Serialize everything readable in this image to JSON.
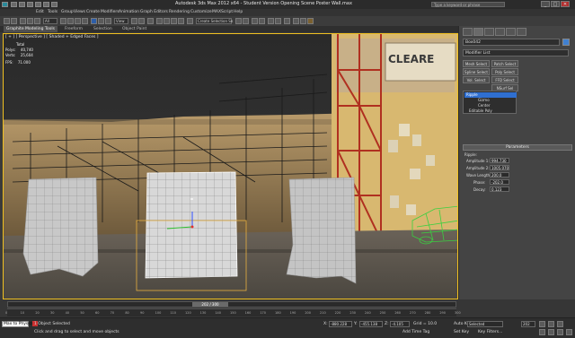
{
  "window": {
    "title": "Autodesk 3ds Max 2012 x64  -  Student Version    Opening Scene Poster Wall.max",
    "search_placeholder": "Type a keyword or phrase",
    "min_label": "_",
    "max_label": "□",
    "close_label": "✕"
  },
  "menu": {
    "items": [
      "Edit",
      "Tools",
      "Group",
      "Views",
      "Create",
      "Modifiers",
      "Animation",
      "Graph Editors",
      "Rendering",
      "Customize",
      "MAXScript",
      "Help"
    ]
  },
  "toolbar": {
    "selection_filter": "All",
    "view_dropdown": "View",
    "named_selection": "Create Selection Se"
  },
  "ribbon": {
    "tabs": [
      "Graphite Modeling Tools",
      "Freeform",
      "Selection",
      "Object Paint"
    ]
  },
  "viewport": {
    "label": "[ + ] [ Perspective ] [ Shaded + Edged Faces ]",
    "stats": {
      "header": "Total",
      "polys_label": "Polys:",
      "polys_value": "40,740",
      "verts_label": "Verts:",
      "verts_value": "25,604",
      "fps_label": "FPS:",
      "fps_value": "71.000"
    },
    "poster_text": "CLEARE",
    "colors": {
      "viewport_border": "#f0c020",
      "wire_car": "#3ad040",
      "selected_plane": "#ffffff"
    }
  },
  "command_panel": {
    "object_name": "Box042",
    "modifier_list": "Modifier List",
    "buttons": [
      "Mesh Select",
      "Patch Select",
      "Spline Select",
      "Poly Select",
      "Vol. Select",
      "FFD Select",
      "NSurf Sel"
    ],
    "stack": [
      "Ripple",
      "Gizmo",
      "Center",
      "Editable Poly"
    ],
    "parameters_title": "Parameters",
    "ripple_label": "Ripple:",
    "params": [
      {
        "label": "Amplitude 1:",
        "value": "994.730"
      },
      {
        "label": "Amplitude 2:",
        "value": "1005.070"
      },
      {
        "label": "Wave Length:",
        "value": "200.0"
      },
      {
        "label": "Phase:",
        "value": "-202.0"
      },
      {
        "label": "Decay:",
        "value": "0.123"
      }
    ]
  },
  "timeline": {
    "frame_readout": "202 / 300",
    "ticks": [
      "0",
      "10",
      "20",
      "30",
      "40",
      "50",
      "60",
      "70",
      "80",
      "90",
      "100",
      "110",
      "120",
      "130",
      "140",
      "150",
      "160",
      "170",
      "180",
      "190",
      "200",
      "210",
      "220",
      "230",
      "240",
      "250",
      "260",
      "270",
      "280",
      "290",
      "300"
    ]
  },
  "status": {
    "maxscript": "Max to Physics",
    "selected": "1 Object Selected",
    "prompt": "Click and drag to select and move objects",
    "x_label": "X:",
    "x_value": "-880.228",
    "y_label": "Y:",
    "y_value": "-455.138",
    "z_label": "Z:",
    "z_value": "-4.105",
    "grid": "Grid = 10.0",
    "add_time_tag": "Add Time Tag",
    "auto_key": "Auto Key",
    "set_key": "Set Key",
    "selected_dropdown": "Selected",
    "key_filters": "Key Filters...",
    "frame_field": "202"
  }
}
